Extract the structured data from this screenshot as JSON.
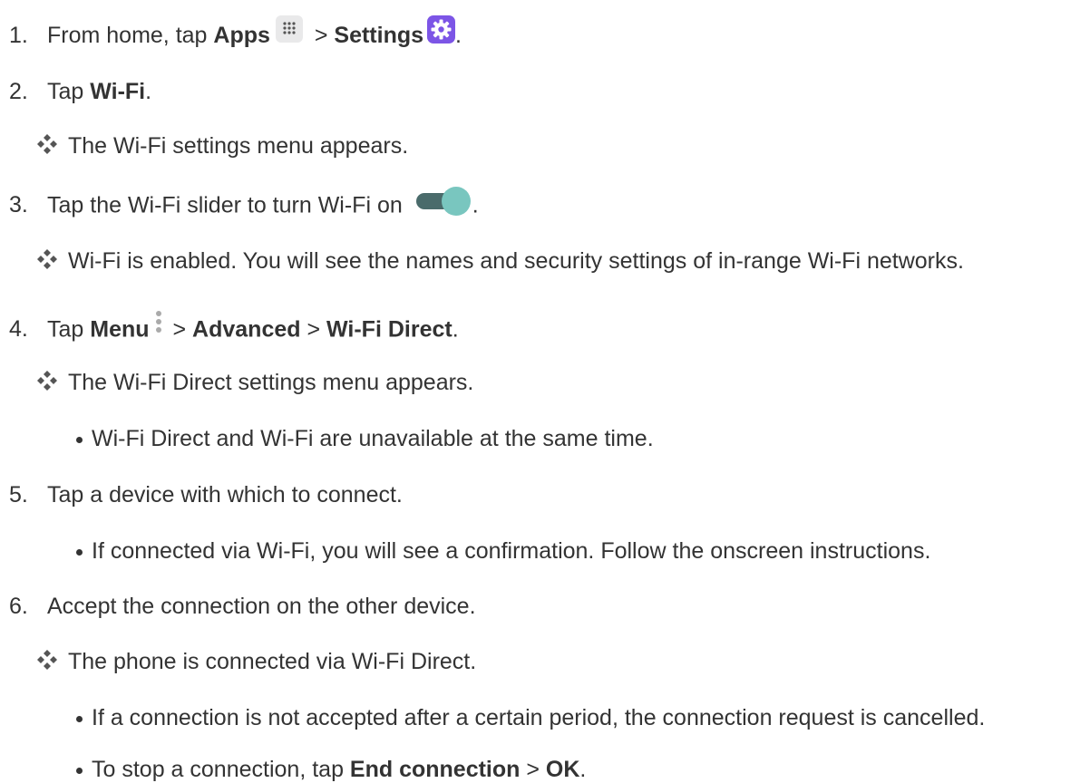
{
  "steps": [
    {
      "number": "1.",
      "parts": [
        "From home, tap ",
        "Apps",
        " > ",
        "Settings",
        "."
      ]
    },
    {
      "number": "2.",
      "parts": [
        "Tap ",
        "Wi-Fi",
        "."
      ]
    },
    {
      "number": "3.",
      "parts": [
        "Tap the Wi-Fi slider to turn Wi-Fi on ",
        "."
      ]
    },
    {
      "number": "4.",
      "parts": [
        "Tap ",
        "Menu",
        " > ",
        "Advanced",
        " > ",
        "Wi-Fi Direct",
        "."
      ]
    },
    {
      "number": "5.",
      "parts": [
        "Tap a device with which to connect."
      ]
    },
    {
      "number": "6.",
      "parts": [
        "Accept the connection on the other device."
      ]
    }
  ],
  "results": [
    "The Wi-Fi settings menu appears.",
    "Wi-Fi is enabled. You will see the names and security settings of in-range Wi-Fi networks.",
    "The Wi-Fi Direct settings menu appears.",
    "The phone is connected via Wi-Fi Direct."
  ],
  "bullets": [
    {
      "parts": [
        "Wi-Fi Direct and Wi-Fi are unavailable at the same time."
      ]
    },
    {
      "parts": [
        "If connected via Wi-Fi, you will see a confirmation. Follow the onscreen instructions."
      ]
    },
    {
      "parts": [
        "If a connection is not accepted after a certain period, the connection request is cancelled."
      ]
    },
    {
      "parts": [
        "To stop a connection, tap ",
        "End connection",
        " > ",
        "OK",
        "."
      ]
    }
  ],
  "icons": {
    "apps": "apps-grid-icon",
    "settings": "settings-gear-icon",
    "toggle": "wifi-toggle-on-icon",
    "menu": "menu-kebab-icon",
    "result_marker": "diamond-bullet-icon"
  },
  "colors": {
    "text": "#333333",
    "settings_icon_bg": "#7c55e6",
    "toggle_track": "#4a6b6b",
    "toggle_knob": "#79c6bf"
  }
}
